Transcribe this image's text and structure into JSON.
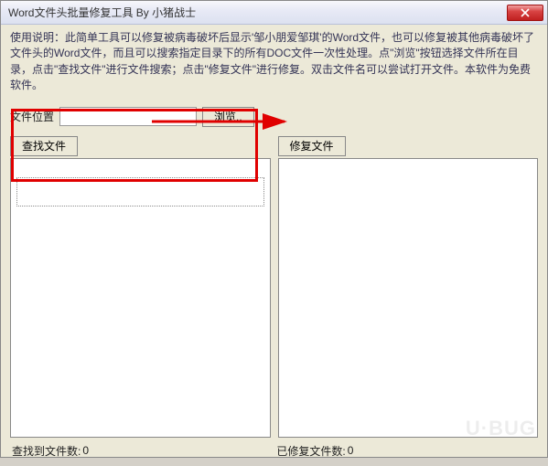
{
  "titlebar": {
    "title": "Word文件头批量修复工具  By 小猪战士",
    "close_icon": "close"
  },
  "instructions": {
    "text": "使用说明：此简单工具可以修复被病毒破坏后显示'邹小朋爱邹琪'的Word文件，也可以修复被其他病毒破坏了文件头的Word文件，而且可以搜索指定目录下的所有DOC文件一次性处理。点\"浏览\"按钮选择文件所在目录，点击\"查找文件\"进行文件搜索；点击\"修复文件\"进行修复。双击文件名可以尝试打开文件。本软件为免费软件。"
  },
  "location": {
    "label": "文件位置",
    "value": "",
    "browse_label": "浏览.."
  },
  "left_panel": {
    "search_label": "查找文件"
  },
  "right_panel": {
    "repair_label": "修复文件"
  },
  "stats": {
    "found_label": "查找到文件数:",
    "found_value": "0",
    "repaired_label": "已修复文件数:",
    "repaired_value": "0"
  },
  "watermark": "U·BUG",
  "annotation": {
    "highlight_target": "search-files-button",
    "arrow_from": "search-files-button",
    "arrow_to": "repair-files-button"
  }
}
